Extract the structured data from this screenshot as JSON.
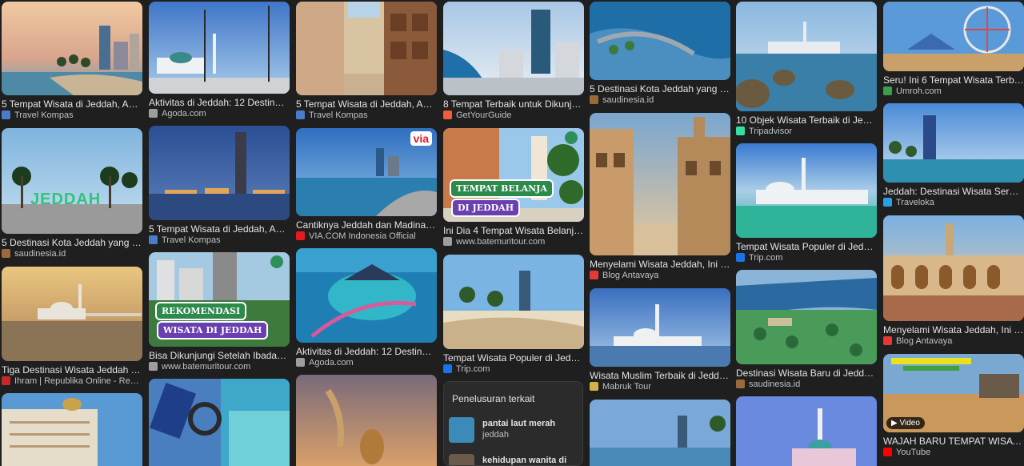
{
  "col1": {
    "r1": {
      "title": "5 Tempat Wisata di Jeddah, Ada Situs...",
      "source": "Travel Kompas"
    },
    "r2": {
      "title": "5 Destinasi Kota Jeddah yang Wajib...",
      "source": "saudinesia.id",
      "sign": "JEDDAH"
    },
    "r3": {
      "title": "Tiga Destinasi Wisata Jeddah yang Bi...",
      "source": "Ihram | Republika Online - Republika"
    }
  },
  "col2": {
    "r1": {
      "title": "Aktivitas di Jeddah: 12 Destinasi...",
      "source": "Agoda.com"
    },
    "r2": {
      "title": "5 Tempat Wisata di Jeddah, Ada Situs...",
      "source": "Travel Kompas"
    },
    "r3": {
      "title": "Bisa Dikunjungi Setelah Ibadah, Ini Di...",
      "source": "www.batemuritour.com",
      "label1": "REKOMENDASI",
      "label2": "WISATA DI JEDDAH"
    }
  },
  "col3": {
    "r1": {
      "title": "5 Tempat Wisata di Jeddah, Ada Situs...",
      "source": "Travel Kompas"
    },
    "r2": {
      "title": "Cantiknya Jeddah dan Madinah, Buka...",
      "source": "VIA.COM Indonesia Official",
      "badge": "via"
    },
    "r3": {
      "title": "Aktivitas di Jeddah: 12 Destinasi...",
      "source": "Agoda.com"
    }
  },
  "col4": {
    "r1": {
      "title": "8 Tempat Terbaik untuk Dikunjungi di...",
      "source": "GetYourGuide"
    },
    "r2": {
      "title": "Ini Dia 4 Tempat Wisata Belanja di...",
      "source": "www.batemuritour.com",
      "label1": "TEMPAT BELANJA",
      "label2": "DI JEDDAH"
    },
    "r3": {
      "title": "Tempat Wisata Populer di Jeddah |...",
      "source": "Trip.com"
    }
  },
  "related": {
    "heading": "Penelusuran terkait",
    "items": [
      {
        "line1": "pantai laut merah",
        "line2": "jeddah"
      },
      {
        "line1": "kehidupan wanita di",
        "line2": ""
      }
    ]
  },
  "col5": {
    "r1": {
      "title": "5 Destinasi Kota Jeddah yang Wajib...",
      "source": "saudinesia.id"
    },
    "r2": {
      "title": "Menyelami Wisata Jeddah, Ini 5 Temp...",
      "source": "Blog Antavaya"
    },
    "r3": {
      "title": "Wisata Muslim Terbaik di Jeddah |...",
      "source": "Mabruk Tour"
    }
  },
  "col6": {
    "r1": {
      "title": "10 Objek Wisata Terbaik di Jeddah -...",
      "source": "Tripadvisor"
    },
    "r2": {
      "title": "Tempat Wisata Populer di Jeddah |...",
      "source": "Trip.com"
    },
    "r3": {
      "title": "Destinasi Wisata Baru di Jeddah...",
      "source": "saudinesia.id"
    }
  },
  "col7": {
    "r1": {
      "title": "Seru! Ini 6 Tempat Wisata Terbaik di...",
      "source": "Umroh.com"
    },
    "r2": {
      "title": "Jeddah: Destinasi Wisata Seru di...",
      "source": "Traveloka"
    },
    "r3": {
      "title": "Menyelami Wisata Jeddah, Ini 5 Temp...",
      "source": "Blog Antavaya"
    },
    "r4": {
      "title": "WAJAH BARU TEMPAT WISATA YG SIA...",
      "source": "YouTube",
      "badge": "Video"
    }
  }
}
